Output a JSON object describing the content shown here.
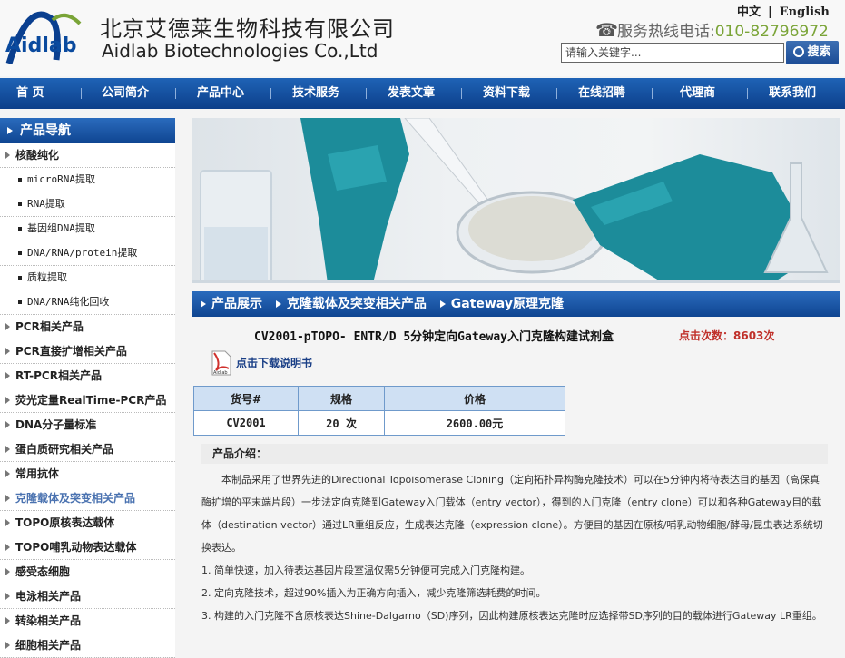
{
  "header": {
    "logo_text": "Aidlab",
    "company_cn": "北京艾德莱生物科技有限公司",
    "company_en": "Aidlab Biotechnologies Co.,Ltd",
    "lang_cn": "中文",
    "lang_sep": "|",
    "lang_en": "English",
    "hotline_label": "服务热线电话:",
    "hotline_number": "010-82796972",
    "search_placeholder": "请输入关键字...",
    "search_button": "搜索"
  },
  "nav": [
    "首 页",
    "公司简介",
    "产品中心",
    "技术服务",
    "发表文章",
    "资料下载",
    "在线招聘",
    "代理商",
    "联系我们"
  ],
  "sidebar": {
    "title": "产品导航",
    "items": [
      {
        "label": "核酸纯化",
        "type": "cat"
      },
      {
        "label": "microRNA提取",
        "type": "sub"
      },
      {
        "label": "RNA提取",
        "type": "sub"
      },
      {
        "label": "基因组DNA提取",
        "type": "sub"
      },
      {
        "label": "DNA/RNA/protein提取",
        "type": "sub"
      },
      {
        "label": "质粒提取",
        "type": "sub"
      },
      {
        "label": "DNA/RNA纯化回收",
        "type": "sub"
      },
      {
        "label": "PCR相关产品",
        "type": "cat"
      },
      {
        "label": "PCR直接扩增相关产品",
        "type": "cat"
      },
      {
        "label": "RT-PCR相关产品",
        "type": "cat"
      },
      {
        "label": "荧光定量RealTime-PCR产品",
        "type": "cat"
      },
      {
        "label": "DNA分子量标准",
        "type": "cat"
      },
      {
        "label": "蛋白质研究相关产品",
        "type": "cat"
      },
      {
        "label": "常用抗体",
        "type": "cat"
      },
      {
        "label": "克隆载体及突变相关产品",
        "type": "cat",
        "active": true
      },
      {
        "label": "TOPO原核表达载体",
        "type": "cat"
      },
      {
        "label": "TOPO哺乳动物表达载体",
        "type": "cat"
      },
      {
        "label": "感受态细胞",
        "type": "cat"
      },
      {
        "label": "电泳相关产品",
        "type": "cat"
      },
      {
        "label": "转染相关产品",
        "type": "cat"
      },
      {
        "label": "细胞相关产品",
        "type": "cat"
      }
    ]
  },
  "breadcrumb": [
    "产品展示",
    "克隆载体及突变相关产品",
    "Gateway原理克隆"
  ],
  "product": {
    "title": "CV2001-pTOPO- ENTR/D 5分钟定向Gateway入门克隆构建试剂盒",
    "hits": "点击次数：8603次",
    "download_link": "点击下载说明书",
    "pdf_label": "Aidlab",
    "table": {
      "headers": [
        "货号#",
        "规格",
        "价格"
      ],
      "row": [
        "CV2001",
        "20 次",
        "2600.00元"
      ]
    },
    "intro_title": "产品介绍：",
    "intro_paragraph": "本制品采用了世界先进的Directional Topoisomerase Cloning（定向拓扑异构酶克隆技术）可以在5分钟内将待表达目的基因（高保真酶扩增的平末端片段）一步法定向克隆到Gateway入门载体（entry vector），得到的入门克隆（entry clone）可以和各种Gateway目的载体（destination vector）通过LR重组反应，生成表达克隆（expression clone）。方便目的基因在原核/哺乳动物细胞/酵母/昆虫表达系统切换表达。",
    "features": [
      "1. 简单快速，加入待表达基因片段室温仅需5分钟便可完成入门克隆构建。",
      "2. 定向克隆技术，超过90%插入为正确方向插入，减少克隆筛选耗费的时间。",
      "3. 构建的入门克隆不含原核表达Shine-Dalgarno（SD)序列，因此构建原核表达克隆时应选择带SD序列的目的载体进行Gateway LR重组。"
    ]
  },
  "colors": {
    "nav_blue": "#1a56a6",
    "hotline_green": "#7aa437",
    "hits_red": "#c0302a",
    "active_side": "#4a72b0"
  }
}
